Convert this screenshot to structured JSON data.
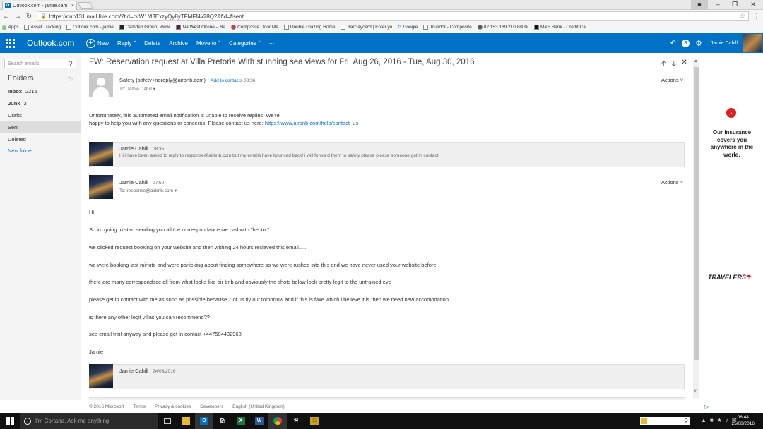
{
  "browser": {
    "tab_title": "Outlook.com - jamie.cahi",
    "tab_close": "×",
    "url": "https://dub131.mail.live.com/?tid=cvW1M3ExzyQy8yTFMFf4v28Q2&fid=flsent",
    "bookmarks": [
      "Apps",
      "Asset Tracking",
      "Outlook.com - jamie",
      "Camden Group; www.",
      "NatWest Online – Ba",
      "Composite Door Ma",
      "Double Glazing Home",
      "Barclaycard | Enter yo",
      "Google",
      "Truedor - Composite",
      "82.153.169.210:8800/",
      "M&S Bank - Credit Ca"
    ]
  },
  "header": {
    "brand": "Outlook.com",
    "new_label": "New",
    "reply_label": "Reply",
    "delete_label": "Delete",
    "archive_label": "Archive",
    "moveto_label": "Move to",
    "categories_label": "Categories",
    "more_label": "···",
    "user_name": "Jamie Cahill"
  },
  "sidebar": {
    "search_placeholder": "Search emails",
    "folders_heading": "Folders",
    "items": [
      {
        "label": "Inbox",
        "count": "2215",
        "bold": true
      },
      {
        "label": "Junk",
        "count": "3",
        "bold": true
      },
      {
        "label": "Drafts",
        "count": "",
        "bold": false
      },
      {
        "label": "Sent",
        "count": "",
        "bold": false
      },
      {
        "label": "Deleted",
        "count": "",
        "bold": false
      }
    ],
    "new_folder": "New folder"
  },
  "conversation": {
    "subject": "FW: Reservation request at Villa Pretoria With stunning sea views for Fri, Aug 26, 2016 - Tue, Aug 30, 2016",
    "msg1": {
      "from": "Safety (safety+noreply@airbnb.com)",
      "add_contacts": "Add to contacts",
      "time": "08:36",
      "to": "To: Jamie Cahill",
      "actions": "Actions",
      "body_line1": "Unfortunately, this automated email notification is unable to receive replies. We're",
      "body_line2": "happy to help you with any questions or concerns. Please contact us here:",
      "body_link": "https://www.airbnb.com/help/contact_us"
    },
    "msg2": {
      "from": "Jamie Cahill",
      "time": "08:35",
      "preview": "Hi i have been asked to reply to response@airbnb.com but my emails have bounced back! i will forward them to safety please please someone get in contact"
    },
    "msg3": {
      "from": "Jamie Cahill",
      "time": "07:50",
      "to": "To: response@airbnb.com",
      "actions": "Actions",
      "lines": [
        "Hi",
        "So im going to start sending you all the correspondance ive had with \"hector\"",
        "we clicked request booking on your website and then withing 24 hours recieved this email.....",
        "we were booking last minute and were panicking about finding somewhere so we were rushed into this and we have never used your website before",
        "there are many correspondace all from what looks like air bnb and obviously the shots below look pretty legit to the untrained eye",
        "please get in contact with me as soon as possible because 7 of us fly out tomorrow and if this is fake which i believe it is then we need new accomodation",
        "is there any other legit villas you can recommend??",
        "see email trail anyway and please get in contact +447584432968",
        "Jamie"
      ]
    },
    "msg4": {
      "from": "Jamie Cahill",
      "time": "24/08/2016"
    }
  },
  "ad": {
    "text": "Our insurance covers you anywhere in the world.",
    "logo": "TRAVELERS"
  },
  "footer": [
    "© 2016 Microsoft",
    "Terms",
    "Privacy & cookies",
    "Developers",
    "English (United Kingdom)"
  ],
  "taskbar": {
    "cortana": "I'm Cortana. Ask me anything.",
    "time": "08:44",
    "date": "25/08/2016"
  },
  "colors": {
    "outlook_blue": "#0072c6",
    "ad_red": "#e02020"
  }
}
